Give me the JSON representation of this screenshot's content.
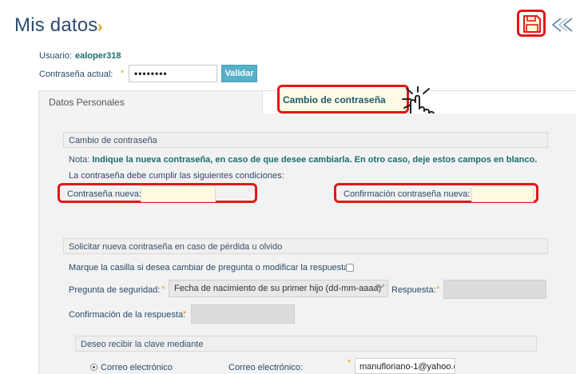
{
  "header": {
    "title": "Mis datos",
    "title_chevron": "›",
    "save_icon": "save-icon",
    "back_icon": "back-icon"
  },
  "user": {
    "label": "Usuario:",
    "value": "ealoper318"
  },
  "current_password": {
    "label": "Contraseña actual:",
    "required": "*",
    "value": "••••••••",
    "validate_button": "Validar"
  },
  "tabs": [
    {
      "label": "Datos Personales",
      "active": false
    },
    {
      "label": "Cambio de contraseña",
      "active": true
    }
  ],
  "change_password": {
    "section_title": "Cambio de contraseña",
    "note_label": "Nota:",
    "note_text": "Indique la nueva contraseña, en caso de que desee cambiarla. En otro caso, deje estos campos en blanco.",
    "conditions_text": "La contraseña debe cumplir las siguientes condiciones:",
    "new_password_label": "Contraseña nueva:",
    "new_password_value": "",
    "confirm_password_label": "Confirmación contraseña nueva:",
    "confirm_password_value": ""
  },
  "recovery": {
    "section_title": "Solicitar nueva contraseña en caso de pérdida u olvido",
    "checkbox_label": "Marque la casilla si desea cambiar de pregunta o modificar la respuesta:",
    "checkbox_checked": false,
    "question_label": "Pregunta de seguridad:",
    "question_value": "Fecha de nacimiento de su primer hijo (dd-mm-aaaa)",
    "answer_label": "Respuesta:",
    "answer_value": "",
    "confirm_answer_label": "Confirmación de la respuesta:",
    "confirm_answer_value": "",
    "required": "*"
  },
  "delivery": {
    "section_title": "Deseo recibir la clave mediante",
    "option_label": "Correo electrónico",
    "email_label": "Correo electrónico:",
    "email_value": "manufloriano-1@yahoo.c",
    "required": "*"
  },
  "colors": {
    "accent_red": "#e01818",
    "validate_blue": "#55b0c8",
    "title_blue": "#2c4d6e",
    "required_orange": "#f0a020"
  }
}
